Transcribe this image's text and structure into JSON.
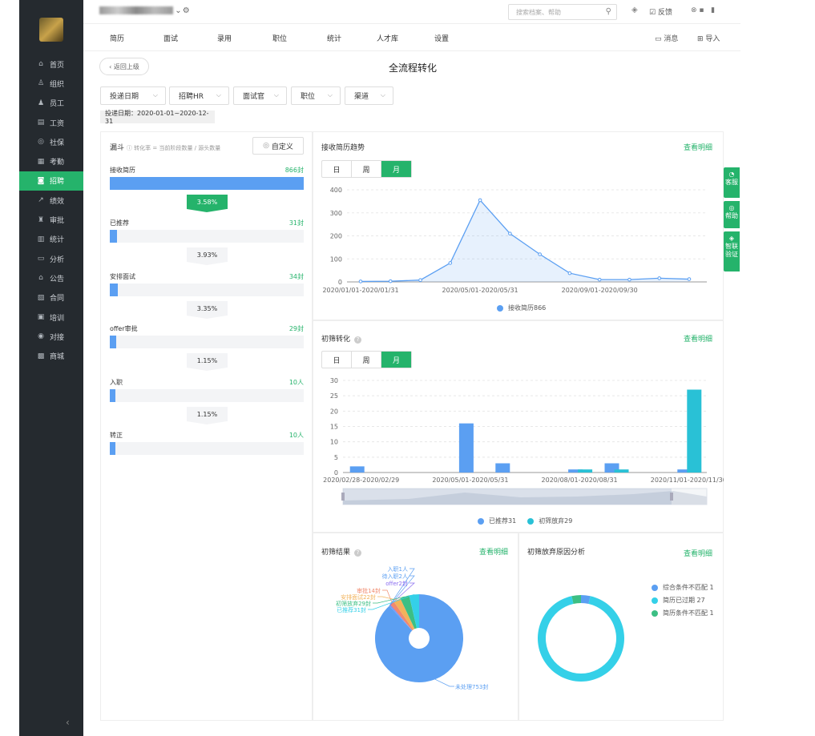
{
  "sidebar": {
    "items": [
      {
        "label": "首页",
        "icon": "home-icon",
        "glyph": "⌂"
      },
      {
        "label": "组织",
        "icon": "org-icon",
        "glyph": "♙"
      },
      {
        "label": "员工",
        "icon": "staff-icon",
        "glyph": "♟"
      },
      {
        "label": "工资",
        "icon": "salary-icon",
        "glyph": "▤"
      },
      {
        "label": "社保",
        "icon": "insurance-icon",
        "glyph": "◎"
      },
      {
        "label": "考勤",
        "icon": "attendance-icon",
        "glyph": "▦"
      },
      {
        "label": "招聘",
        "icon": "recruit-icon",
        "glyph": "◙"
      },
      {
        "label": "绩效",
        "icon": "performance-icon",
        "glyph": "↗"
      },
      {
        "label": "审批",
        "icon": "approval-icon",
        "glyph": "♜"
      },
      {
        "label": "统计",
        "icon": "stats-icon",
        "glyph": "▥"
      },
      {
        "label": "分析",
        "icon": "analysis-icon",
        "glyph": "▭"
      },
      {
        "label": "公告",
        "icon": "notice-icon",
        "glyph": "⌂"
      },
      {
        "label": "合同",
        "icon": "contract-icon",
        "glyph": "▧"
      },
      {
        "label": "培训",
        "icon": "training-icon",
        "glyph": "▣"
      },
      {
        "label": "对接",
        "icon": "connect-icon",
        "glyph": "◉"
      },
      {
        "label": "商城",
        "icon": "mall-icon",
        "glyph": "▩"
      }
    ],
    "active_index": 6,
    "collapse_glyph": "‹"
  },
  "topbar": {
    "search_placeholder": "搜索档案、帮助",
    "feedback": "反馈"
  },
  "nav": {
    "items": [
      "简历",
      "面试",
      "录用",
      "职位",
      "统计",
      "人才库",
      "设置"
    ],
    "messages": "消息",
    "import": "导入"
  },
  "page": {
    "back": "返回上级",
    "title": "全流程转化",
    "filters": [
      "投递日期",
      "招聘HR",
      "面试官",
      "职位",
      "渠道"
    ],
    "date_tag": "投递日期：2020-01-01~2020-12-31"
  },
  "funnel": {
    "title": "漏斗",
    "hint": "转化率 = 当前阶段数量 / 源头数量",
    "custom": "自定义",
    "stages": [
      {
        "label": "接收简历",
        "count": "866封",
        "value": 866
      },
      {
        "label": "已推荐",
        "count": "31封",
        "value": 31
      },
      {
        "label": "安排面试",
        "count": "34封",
        "value": 34
      },
      {
        "label": "offer审批",
        "count": "29封",
        "value": 29
      },
      {
        "label": "入职",
        "count": "10人",
        "value": 10
      },
      {
        "label": "转正",
        "count": "10人",
        "value": 10
      }
    ],
    "rates": [
      "3.58%",
      "3.93%",
      "3.35%",
      "1.15%",
      "1.15%"
    ]
  },
  "trend": {
    "title": "接收简历趋势",
    "link": "查看明细",
    "segments": [
      "日",
      "周",
      "月"
    ],
    "active_segment": 2,
    "legend": "接收简历866",
    "color": "#5b9ff2"
  },
  "screening": {
    "title": "初筛转化",
    "link": "查看明细",
    "segments": [
      "日",
      "周",
      "月"
    ],
    "active_segment": 2,
    "legend": [
      "已推荐31",
      "初筛放弃29"
    ],
    "colors": [
      "#5b9ff2",
      "#29c1d6"
    ]
  },
  "result": {
    "title": "初筛结果",
    "link": "查看明细"
  },
  "reasons": {
    "title": "初筛放弃原因分析",
    "link": "查看明细",
    "legend": [
      "综合条件不匹配 1",
      "简历已过期 27",
      "简历条件不匹配 1"
    ],
    "colors": [
      "#5b9ff2",
      "#34d0e8",
      "#3cbf84"
    ]
  },
  "float_tabs": [
    "客服",
    "帮助",
    "智联验证"
  ],
  "chart_data": [
    {
      "type": "area",
      "title": "接收简历趋势",
      "x": [
        "2020/01/01-2020/01/31",
        "2020/02",
        "2020/03",
        "2020/04",
        "2020/05/01-2020/05/31",
        "2020/06",
        "2020/07",
        "2020/08",
        "2020/09/01-2020/09/30",
        "2020/10",
        "2020/11",
        "2020/12"
      ],
      "x_ticks": [
        "2020/01/01-2020/01/31",
        "2020/05/01-2020/05/31",
        "2020/09/01-2020/09/30"
      ],
      "series": [
        {
          "name": "接收简历866",
          "values": [
            2,
            3,
            8,
            82,
            355,
            210,
            120,
            38,
            10,
            10,
            16,
            12
          ]
        }
      ],
      "ylim": [
        0,
        400
      ],
      "yticks": [
        0,
        100,
        200,
        300,
        400
      ],
      "grid": true
    },
    {
      "type": "bar",
      "title": "初筛转化",
      "x": [
        "2020/02/28-2020/02/29",
        "2020/03",
        "2020/04",
        "2020/05/01-2020/05/31",
        "2020/06",
        "2020/07",
        "2020/08/01-2020/08/31",
        "2020/09",
        "2020/10",
        "2020/11/01-2020/11/30"
      ],
      "x_ticks": [
        "2020/02/28-2020/02/29",
        "2020/05/01-2020/05/31",
        "2020/08/01-2020/08/31",
        "2020/11/01-2020/11/30"
      ],
      "series": [
        {
          "name": "已推荐31",
          "values": [
            2,
            0,
            0,
            16,
            3,
            0,
            1,
            3,
            0,
            1
          ]
        },
        {
          "name": "初筛放弃29",
          "values": [
            0,
            0,
            0,
            0,
            0,
            0,
            1,
            1,
            0,
            27
          ]
        }
      ],
      "ylim": [
        0,
        30
      ],
      "yticks": [
        0,
        5,
        10,
        15,
        20,
        25,
        30
      ],
      "grid": true
    },
    {
      "type": "pie",
      "title": "初筛结果",
      "labels": [
        "入职1人",
        "待入职2人",
        "offer2封",
        "审批14封",
        "安排面试22封",
        "初筛放弃29封",
        "已推荐31封",
        "未处理753封"
      ],
      "values": [
        1,
        2,
        2,
        14,
        22,
        29,
        31,
        753
      ],
      "colors": [
        "#5b9ff2",
        "#5b9ff2",
        "#8a6df0",
        "#f08a6d",
        "#f2b35b",
        "#3cbf84",
        "#34d0e8",
        "#5b9ff2"
      ]
    },
    {
      "type": "pie",
      "title": "初筛放弃原因分析",
      "labels": [
        "综合条件不匹配 1",
        "简历已过期 27",
        "简历条件不匹配 1"
      ],
      "values": [
        1,
        27,
        1
      ],
      "colors": [
        "#5b9ff2",
        "#34d0e8",
        "#3cbf84"
      ]
    }
  ]
}
